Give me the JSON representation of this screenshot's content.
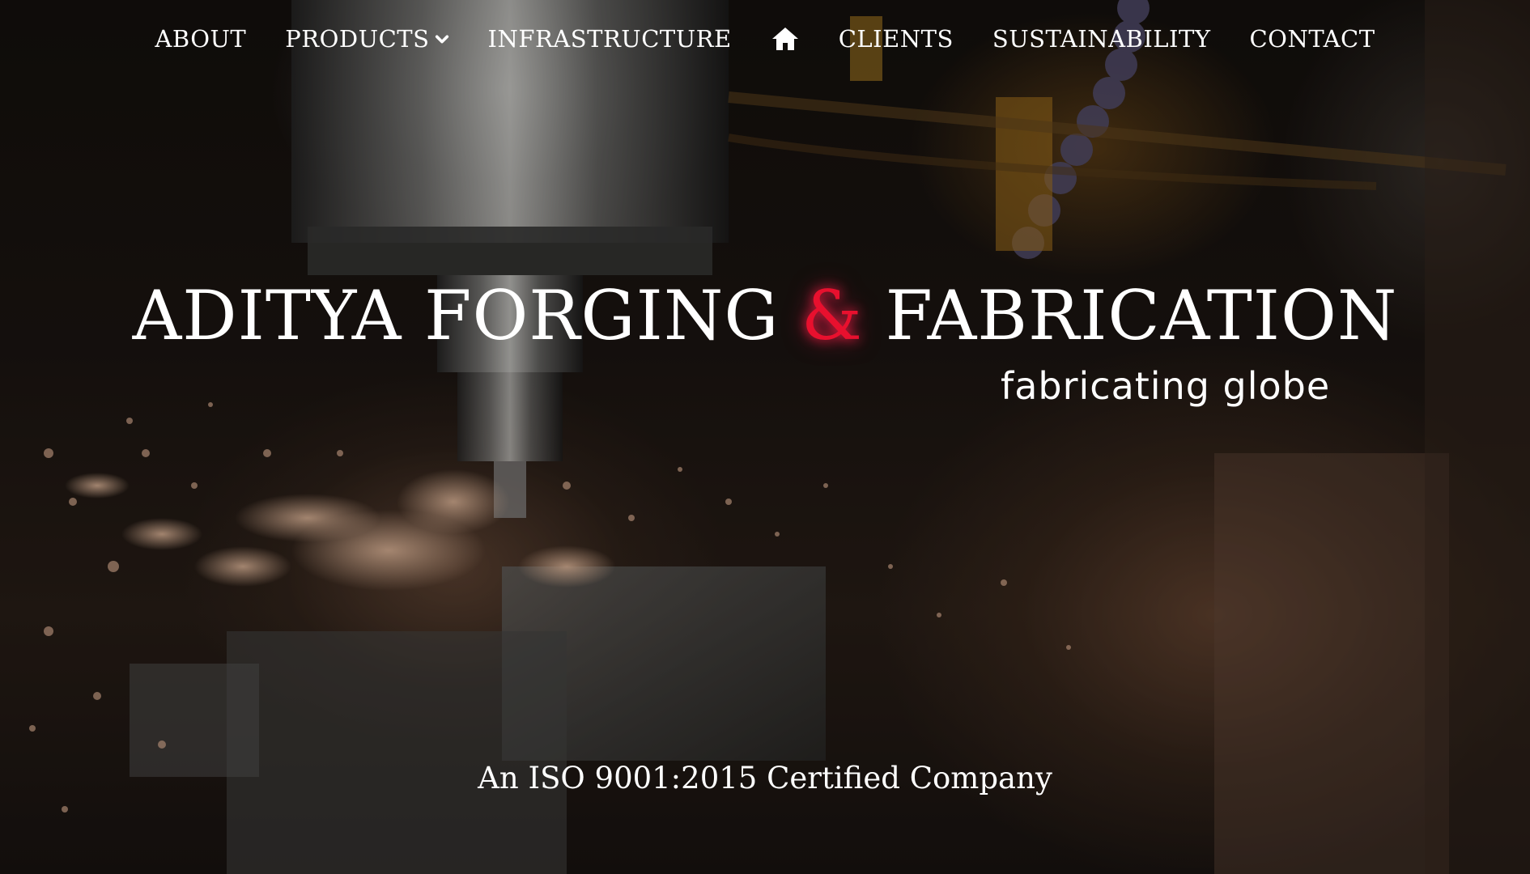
{
  "nav": {
    "about": "ABOUT",
    "products": "PRODUCTS",
    "infrastructure": "INFRASTRUCTURE",
    "home_icon": "home-icon",
    "clients": "CLIENTS",
    "sustainability": "SUSTAINABILITY",
    "contact": "CONTACT"
  },
  "hero": {
    "title_part1": "ADITYA FORGING ",
    "title_amp": "&",
    "title_part2": " FABRICATION",
    "tagline": "fabricating globe",
    "certification": "An ISO 9001:2015 Certified Company"
  },
  "colors": {
    "accent": "#e8102e",
    "text": "#ffffff"
  }
}
